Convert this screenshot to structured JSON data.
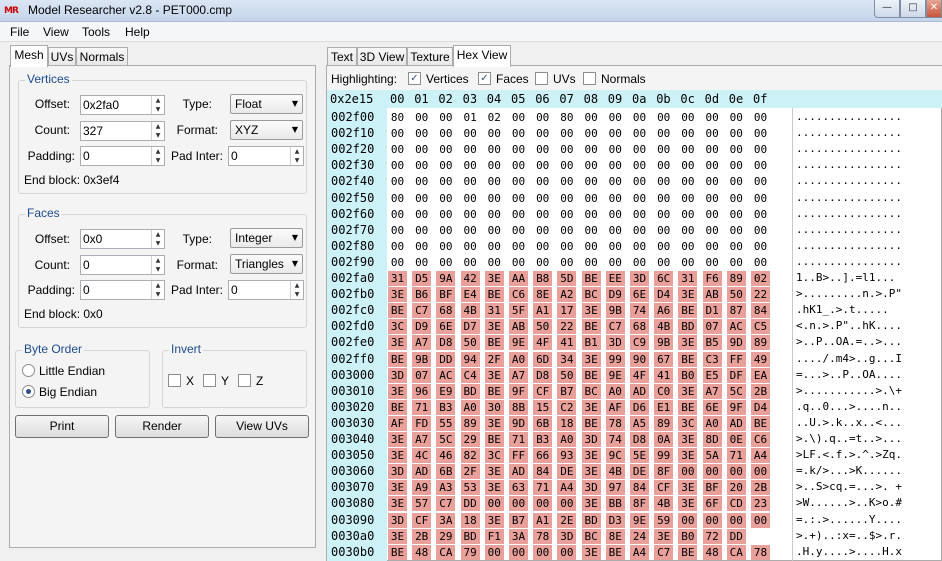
{
  "window": {
    "title": "Model Researcher v2.8 - PET000.cmp",
    "app_icon": "MR"
  },
  "menu": [
    "File",
    "View",
    "Tools",
    "Help"
  ],
  "left_tabs": [
    "Mesh",
    "UVs",
    "Normals"
  ],
  "vertices": {
    "title": "Vertices",
    "offset_label": "Offset:",
    "offset": "0x2fa0",
    "count_label": "Count:",
    "count": "327",
    "padding_label": "Padding:",
    "padding": "0",
    "type_label": "Type:",
    "type": "Float",
    "format_label": "Format:",
    "format": "XYZ",
    "padinter_label": "Pad Inter:",
    "padinter": "0",
    "end_block": "End block: 0x3ef4"
  },
  "faces": {
    "title": "Faces",
    "offset_label": "Offset:",
    "offset": "0x0",
    "count_label": "Count:",
    "count": "0",
    "padding_label": "Padding:",
    "padding": "0",
    "type_label": "Type:",
    "type": "Integer",
    "format_label": "Format:",
    "format": "Triangles",
    "padinter_label": "Pad Inter:",
    "padinter": "0",
    "end_block": "End block: 0x0"
  },
  "byte_order": {
    "title": "Byte Order",
    "options": [
      "Little Endian",
      "Big Endian"
    ],
    "selected": "Big Endian"
  },
  "invert": {
    "title": "Invert",
    "axes": [
      "X",
      "Y",
      "Z"
    ]
  },
  "buttons": {
    "print": "Print",
    "render": "Render",
    "view_uvs": "View UVs"
  },
  "right_tabs": [
    "Text",
    "3D View",
    "Texture",
    "Hex View"
  ],
  "highlighting": {
    "label": "Highlighting:",
    "items": [
      {
        "label": "Vertices",
        "checked": true
      },
      {
        "label": "Faces",
        "checked": true
      },
      {
        "label": "UVs",
        "checked": false
      },
      {
        "label": "Normals",
        "checked": false
      }
    ]
  },
  "hex": {
    "cursor": "0x2e15",
    "columns": [
      "00",
      "01",
      "02",
      "03",
      "04",
      "05",
      "06",
      "07",
      "08",
      "09",
      "0a",
      "0b",
      "0c",
      "0d",
      "0e",
      "0f"
    ],
    "highlight_color": "#e9a09a",
    "rows": [
      {
        "addr": "002f00",
        "bytes": "80 00 00 01 02 00 00 80 00 00 00 00 00 00 00 00",
        "ascii": "................",
        "hl_from": 16
      },
      {
        "addr": "002f10",
        "bytes": "00 00 00 00 00 00 00 00 00 00 00 00 00 00 00 00",
        "ascii": "................",
        "hl_from": 16
      },
      {
        "addr": "002f20",
        "bytes": "00 00 00 00 00 00 00 00 00 00 00 00 00 00 00 00",
        "ascii": "................",
        "hl_from": 16
      },
      {
        "addr": "002f30",
        "bytes": "00 00 00 00 00 00 00 00 00 00 00 00 00 00 00 00",
        "ascii": "................",
        "hl_from": 16
      },
      {
        "addr": "002f40",
        "bytes": "00 00 00 00 00 00 00 00 00 00 00 00 00 00 00 00",
        "ascii": "................",
        "hl_from": 16
      },
      {
        "addr": "002f50",
        "bytes": "00 00 00 00 00 00 00 00 00 00 00 00 00 00 00 00",
        "ascii": "................",
        "hl_from": 16
      },
      {
        "addr": "002f60",
        "bytes": "00 00 00 00 00 00 00 00 00 00 00 00 00 00 00 00",
        "ascii": "................",
        "hl_from": 16
      },
      {
        "addr": "002f70",
        "bytes": "00 00 00 00 00 00 00 00 00 00 00 00 00 00 00 00",
        "ascii": "................",
        "hl_from": 16
      },
      {
        "addr": "002f80",
        "bytes": "00 00 00 00 00 00 00 00 00 00 00 00 00 00 00 00",
        "ascii": "................",
        "hl_from": 16
      },
      {
        "addr": "002f90",
        "bytes": "00 00 00 00 00 00 00 00 00 00 00 00 00 00 00 00",
        "ascii": "................",
        "hl_from": 16
      },
      {
        "addr": "002fa0",
        "bytes": "31 D5 9A 42 3E AA B8 5D BE EE 3D 6C 31 F6 89 02",
        "ascii": "1..B>..].=l1...",
        "hl_from": 0
      },
      {
        "addr": "002fb0",
        "bytes": "3E B6 BF E4 BE C6 8E A2 BC D9 6E D4 3E AB 50 22",
        "ascii": ">.........n.>.P\"",
        "hl_from": 0
      },
      {
        "addr": "002fc0",
        "bytes": "BE C7 68 4B 31 5F A1 17 3E 9B 74 A6 BE D1 87 84",
        "ascii": ".hK1_.>.t.....",
        "hl_from": 0
      },
      {
        "addr": "002fd0",
        "bytes": "3C D9 6E D7 3E AB 50 22 BE C7 68 4B BD 07 AC C5",
        "ascii": "<.n.>.P\"..hK....",
        "hl_from": 0
      },
      {
        "addr": "002fe0",
        "bytes": "3E A7 D8 50 BE 9E 4F 41 B1 3D C9 9B 3E B5 9D 89",
        "ascii": ">..P..OA.=..>...",
        "hl_from": 0
      },
      {
        "addr": "002ff0",
        "bytes": "BE 9B DD 94 2F A0 6D 34 3E 99 90 67 BE C3 FF 49",
        "ascii": "..../.m4>..g...I",
        "hl_from": 0
      },
      {
        "addr": "003000",
        "bytes": "3D 07 AC C4 3E A7 D8 50 BE 9E 4F 41 B0 E5 DF EA",
        "ascii": "=...>..P..OA....",
        "hl_from": 0
      },
      {
        "addr": "003010",
        "bytes": "3E 96 E9 BD BE 9F CF B7 BC A0 AD C0 3E A7 5C 2B",
        "ascii": ">...........>.\\+",
        "hl_from": 0
      },
      {
        "addr": "003020",
        "bytes": "BE 71 B3 A0 30 8B 15 C2 3E AF D6 E1 BE 6E 9F D4",
        "ascii": ".q..0...>....n..",
        "hl_from": 0
      },
      {
        "addr": "003030",
        "bytes": "AF FD 55 89 3E 9D 6B 18 BE 78 A5 89 3C A0 AD BE",
        "ascii": "..U.>.k..x..<...",
        "hl_from": 0
      },
      {
        "addr": "003040",
        "bytes": "3E A7 5C 29 BE 71 B3 A0 3D 74 D8 0A 3E 8D 0E C6",
        "ascii": ">.\\).q..=t..>...",
        "hl_from": 0
      },
      {
        "addr": "003050",
        "bytes": "3E 4C 46 82 3C FF 66 93 3E 9C 5E 99 3E 5A 71 A4",
        "ascii": ">LF.<.f.>.^.>Zq.",
        "hl_from": 0
      },
      {
        "addr": "003060",
        "bytes": "3D AD 6B 2F 3E AD 84 DE 3E 4B DE 8F 00 00 00 00",
        "ascii": "=.k/>...>K......",
        "hl_from": 0
      },
      {
        "addr": "003070",
        "bytes": "3E A9 A3 53 3E 63 71 A4 3D 97 84 CF 3E BF 20 2B",
        "ascii": ">..S>cq.=...>. +",
        "hl_from": 0
      },
      {
        "addr": "003080",
        "bytes": "3E 57 C7 DD 00 00 00 00 3E BB 8F 4B 3E 6F CD 23",
        "ascii": ">W......>..K>o.#",
        "hl_from": 0
      },
      {
        "addr": "003090",
        "bytes": "3D CF 3A 18 3E B7 A1 2E BD D3 9E 59 00 00 00 00",
        "ascii": "=.:.>......Y....",
        "hl_from": 0
      },
      {
        "addr": "0030a0",
        "bytes": "3E 2B 29 BD F1 3A 78 3D BC 8E 24 3E B0 72 DD",
        "ascii": ">.+)..:x=..$>.r.",
        "hl_from": 0
      },
      {
        "addr": "0030b0",
        "bytes": "BE 48 CA 79 00 00 00 00 3E BE A4 C7 BE 48 CA 78",
        "ascii": ".H.y....>....H.x",
        "hl_from": 0
      }
    ]
  }
}
